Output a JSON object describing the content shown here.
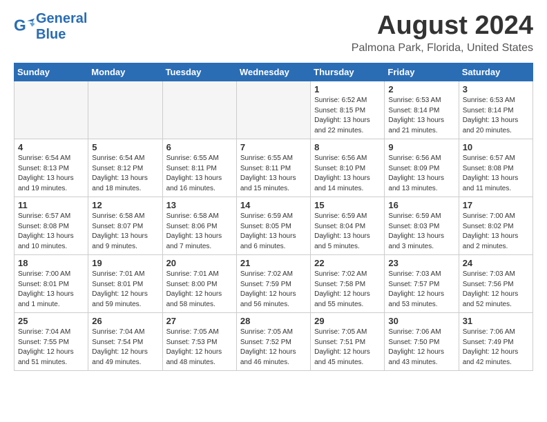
{
  "header": {
    "logo_general": "General",
    "logo_blue": "Blue",
    "month": "August 2024",
    "location": "Palmona Park, Florida, United States"
  },
  "days_of_week": [
    "Sunday",
    "Monday",
    "Tuesday",
    "Wednesday",
    "Thursday",
    "Friday",
    "Saturday"
  ],
  "weeks": [
    [
      {
        "day": "",
        "info": ""
      },
      {
        "day": "",
        "info": ""
      },
      {
        "day": "",
        "info": ""
      },
      {
        "day": "",
        "info": ""
      },
      {
        "day": "1",
        "info": "Sunrise: 6:52 AM\nSunset: 8:15 PM\nDaylight: 13 hours\nand 22 minutes."
      },
      {
        "day": "2",
        "info": "Sunrise: 6:53 AM\nSunset: 8:14 PM\nDaylight: 13 hours\nand 21 minutes."
      },
      {
        "day": "3",
        "info": "Sunrise: 6:53 AM\nSunset: 8:14 PM\nDaylight: 13 hours\nand 20 minutes."
      }
    ],
    [
      {
        "day": "4",
        "info": "Sunrise: 6:54 AM\nSunset: 8:13 PM\nDaylight: 13 hours\nand 19 minutes."
      },
      {
        "day": "5",
        "info": "Sunrise: 6:54 AM\nSunset: 8:12 PM\nDaylight: 13 hours\nand 18 minutes."
      },
      {
        "day": "6",
        "info": "Sunrise: 6:55 AM\nSunset: 8:11 PM\nDaylight: 13 hours\nand 16 minutes."
      },
      {
        "day": "7",
        "info": "Sunrise: 6:55 AM\nSunset: 8:11 PM\nDaylight: 13 hours\nand 15 minutes."
      },
      {
        "day": "8",
        "info": "Sunrise: 6:56 AM\nSunset: 8:10 PM\nDaylight: 13 hours\nand 14 minutes."
      },
      {
        "day": "9",
        "info": "Sunrise: 6:56 AM\nSunset: 8:09 PM\nDaylight: 13 hours\nand 13 minutes."
      },
      {
        "day": "10",
        "info": "Sunrise: 6:57 AM\nSunset: 8:08 PM\nDaylight: 13 hours\nand 11 minutes."
      }
    ],
    [
      {
        "day": "11",
        "info": "Sunrise: 6:57 AM\nSunset: 8:08 PM\nDaylight: 13 hours\nand 10 minutes."
      },
      {
        "day": "12",
        "info": "Sunrise: 6:58 AM\nSunset: 8:07 PM\nDaylight: 13 hours\nand 9 minutes."
      },
      {
        "day": "13",
        "info": "Sunrise: 6:58 AM\nSunset: 8:06 PM\nDaylight: 13 hours\nand 7 minutes."
      },
      {
        "day": "14",
        "info": "Sunrise: 6:59 AM\nSunset: 8:05 PM\nDaylight: 13 hours\nand 6 minutes."
      },
      {
        "day": "15",
        "info": "Sunrise: 6:59 AM\nSunset: 8:04 PM\nDaylight: 13 hours\nand 5 minutes."
      },
      {
        "day": "16",
        "info": "Sunrise: 6:59 AM\nSunset: 8:03 PM\nDaylight: 13 hours\nand 3 minutes."
      },
      {
        "day": "17",
        "info": "Sunrise: 7:00 AM\nSunset: 8:02 PM\nDaylight: 13 hours\nand 2 minutes."
      }
    ],
    [
      {
        "day": "18",
        "info": "Sunrise: 7:00 AM\nSunset: 8:01 PM\nDaylight: 13 hours\nand 1 minute."
      },
      {
        "day": "19",
        "info": "Sunrise: 7:01 AM\nSunset: 8:01 PM\nDaylight: 12 hours\nand 59 minutes."
      },
      {
        "day": "20",
        "info": "Sunrise: 7:01 AM\nSunset: 8:00 PM\nDaylight: 12 hours\nand 58 minutes."
      },
      {
        "day": "21",
        "info": "Sunrise: 7:02 AM\nSunset: 7:59 PM\nDaylight: 12 hours\nand 56 minutes."
      },
      {
        "day": "22",
        "info": "Sunrise: 7:02 AM\nSunset: 7:58 PM\nDaylight: 12 hours\nand 55 minutes."
      },
      {
        "day": "23",
        "info": "Sunrise: 7:03 AM\nSunset: 7:57 PM\nDaylight: 12 hours\nand 53 minutes."
      },
      {
        "day": "24",
        "info": "Sunrise: 7:03 AM\nSunset: 7:56 PM\nDaylight: 12 hours\nand 52 minutes."
      }
    ],
    [
      {
        "day": "25",
        "info": "Sunrise: 7:04 AM\nSunset: 7:55 PM\nDaylight: 12 hours\nand 51 minutes."
      },
      {
        "day": "26",
        "info": "Sunrise: 7:04 AM\nSunset: 7:54 PM\nDaylight: 12 hours\nand 49 minutes."
      },
      {
        "day": "27",
        "info": "Sunrise: 7:05 AM\nSunset: 7:53 PM\nDaylight: 12 hours\nand 48 minutes."
      },
      {
        "day": "28",
        "info": "Sunrise: 7:05 AM\nSunset: 7:52 PM\nDaylight: 12 hours\nand 46 minutes."
      },
      {
        "day": "29",
        "info": "Sunrise: 7:05 AM\nSunset: 7:51 PM\nDaylight: 12 hours\nand 45 minutes."
      },
      {
        "day": "30",
        "info": "Sunrise: 7:06 AM\nSunset: 7:50 PM\nDaylight: 12 hours\nand 43 minutes."
      },
      {
        "day": "31",
        "info": "Sunrise: 7:06 AM\nSunset: 7:49 PM\nDaylight: 12 hours\nand 42 minutes."
      }
    ]
  ]
}
